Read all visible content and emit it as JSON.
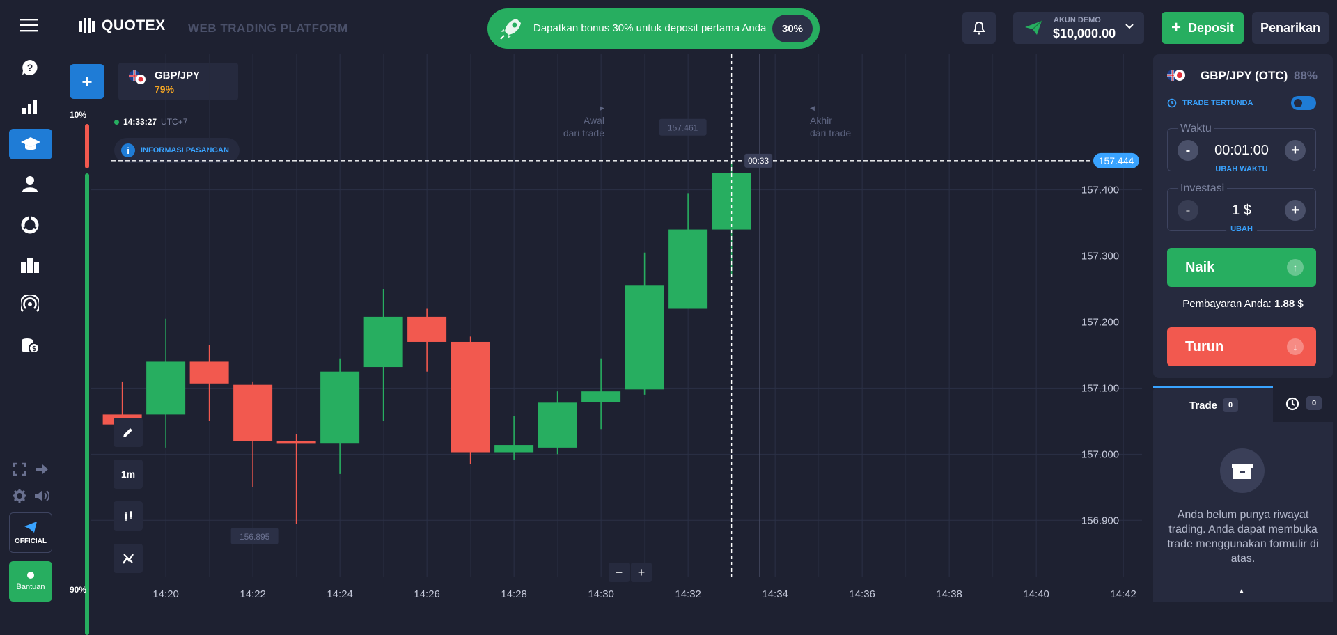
{
  "header": {
    "logo_text": "QUOTEX",
    "platform_text": "WEB TRADING PLATFORM",
    "promo_text": "Dapatkan bonus 30% untuk deposit pertama Anda",
    "promo_badge": "30%",
    "account_label": "AKUN DEMO",
    "account_balance": "$10,000.00",
    "deposit_label": "Deposit",
    "withdraw_label": "Penarikan"
  },
  "sidebar": {
    "official_label": "OFFICIAL",
    "help_label": "Bantuan",
    "sentiment_top": "10%",
    "sentiment_bottom": "90%"
  },
  "chart": {
    "asset_name": "GBP/JPY",
    "asset_payout": "79%",
    "clock_time": "14:33:27",
    "clock_tz": "UTC+7",
    "info_label": "INFORMASI PASANGAN",
    "start_label_1": "Awal",
    "start_label_2": "dari trade",
    "end_label_1": "Akhir",
    "end_label_2": "dari trade",
    "timer_label": "00:33",
    "current_price": "157.444",
    "high_label": "157.461",
    "low_label": "156.895",
    "timeframe_label": "1m"
  },
  "chart_data": {
    "type": "candlestick",
    "y_ticks": [
      "157.400",
      "157.300",
      "157.200",
      "157.100",
      "157.000",
      "156.900"
    ],
    "x_ticks": [
      "14:20",
      "14:22",
      "14:24",
      "14:26",
      "14:28",
      "14:30",
      "14:32",
      "14:34",
      "14:36",
      "14:38",
      "14:40",
      "14:42"
    ],
    "ylim": [
      156.815,
      157.605
    ],
    "candles": [
      {
        "t": "14:19",
        "o": 157.06,
        "h": 157.11,
        "l": 157.02,
        "c": 157.045,
        "dir": "down"
      },
      {
        "t": "14:20",
        "o": 157.06,
        "h": 157.205,
        "l": 157.01,
        "c": 157.14,
        "dir": "up"
      },
      {
        "t": "14:21",
        "o": 157.14,
        "h": 157.165,
        "l": 157.05,
        "c": 157.107,
        "dir": "down"
      },
      {
        "t": "14:22",
        "o": 157.105,
        "h": 157.11,
        "l": 156.95,
        "c": 157.02,
        "dir": "down"
      },
      {
        "t": "14:23",
        "o": 157.02,
        "h": 157.03,
        "l": 156.895,
        "c": 157.017,
        "dir": "down"
      },
      {
        "t": "14:24",
        "o": 157.017,
        "h": 157.145,
        "l": 156.97,
        "c": 157.125,
        "dir": "up"
      },
      {
        "t": "14:25",
        "o": 157.132,
        "h": 157.25,
        "l": 157.05,
        "c": 157.208,
        "dir": "up"
      },
      {
        "t": "14:26",
        "o": 157.208,
        "h": 157.22,
        "l": 157.125,
        "c": 157.17,
        "dir": "down"
      },
      {
        "t": "14:27",
        "o": 157.17,
        "h": 157.178,
        "l": 156.985,
        "c": 157.003,
        "dir": "down"
      },
      {
        "t": "14:28",
        "o": 157.003,
        "h": 157.058,
        "l": 156.992,
        "c": 157.014,
        "dir": "up"
      },
      {
        "t": "14:29",
        "o": 157.01,
        "h": 157.095,
        "l": 157.0,
        "c": 157.078,
        "dir": "up"
      },
      {
        "t": "14:30",
        "o": 157.079,
        "h": 157.145,
        "l": 157.038,
        "c": 157.095,
        "dir": "up"
      },
      {
        "t": "14:31",
        "o": 157.098,
        "h": 157.305,
        "l": 157.09,
        "c": 157.255,
        "dir": "up"
      },
      {
        "t": "14:32",
        "o": 157.22,
        "h": 157.395,
        "l": 157.22,
        "c": 157.34,
        "dir": "up"
      },
      {
        "t": "14:33",
        "o": 157.34,
        "h": 157.444,
        "l": 157.27,
        "c": 157.425,
        "dir": "up"
      }
    ]
  },
  "panel": {
    "asset_title": "GBP/JPY (OTC)",
    "asset_payout": "88%",
    "pending_label": "TRADE TERTUNDA",
    "time_label": "Waktu",
    "time_value": "00:01:00",
    "time_link": "UBAH WAKTU",
    "invest_label": "Investasi",
    "invest_value": "1 $",
    "invest_link": "UBAH",
    "up_label": "Naik",
    "payout_label": "Pembayaran Anda:",
    "payout_value": "1.88 $",
    "down_label": "Turun",
    "trades_tab": "Trade",
    "trades_count": "0",
    "history_count": "0",
    "empty_text": "Anda belum punya riwayat trading. Anda dapat membuka trade menggunakan formulir di atas."
  },
  "colors": {
    "green": "#27ae60",
    "red": "#f2594f",
    "blue": "#39a3ff",
    "background": "#1e2131"
  }
}
